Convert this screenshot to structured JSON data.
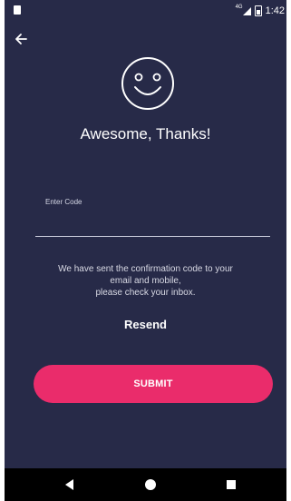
{
  "status_bar": {
    "network": "4G",
    "time": "1:42"
  },
  "header": {
    "back_icon": "arrow-left-icon",
    "emoji_icon": "smiley-face-icon",
    "title": "Awesome, Thanks!"
  },
  "form": {
    "code_label": "Enter Code",
    "code_value": ""
  },
  "info": {
    "line1": "We have sent the confirmation code to your",
    "line2": "email and mobile,",
    "line3": "please check your inbox."
  },
  "actions": {
    "resend_label": "Resend",
    "submit_label": "SUBMIT"
  },
  "colors": {
    "background": "#272a48",
    "accent": "#ea2c6b",
    "nav_bar": "#000000"
  },
  "nav_bar": {
    "icons": [
      "back-triangle-icon",
      "home-circle-icon",
      "recents-square-icon"
    ]
  }
}
